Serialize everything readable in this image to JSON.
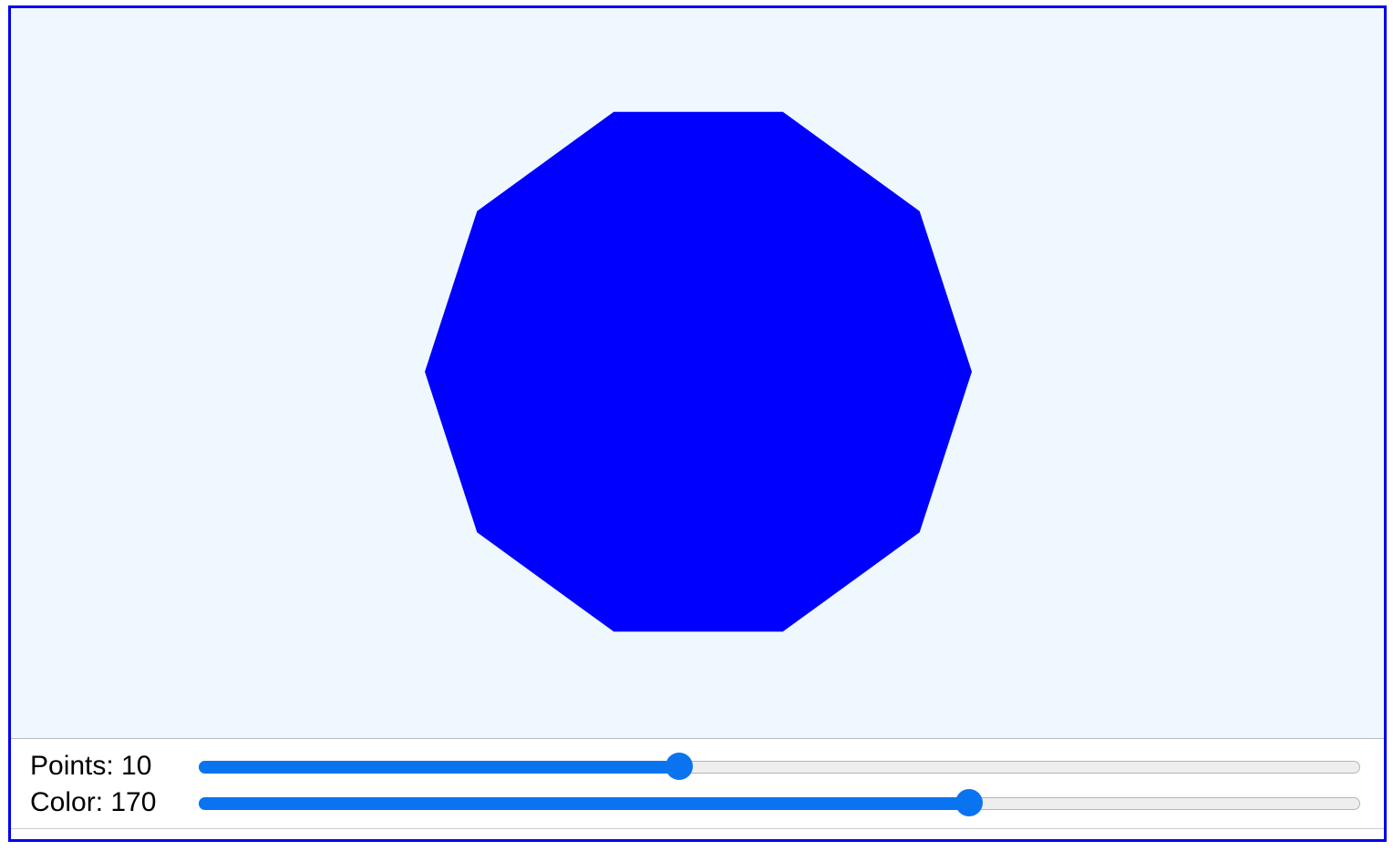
{
  "canvas": {
    "background_color": "#f0f8ff",
    "shape": {
      "type": "regular-polygon",
      "sides": 10,
      "fill_color": "#0000ff"
    }
  },
  "controls": {
    "points": {
      "label": "Points: 10",
      "value": 10,
      "fill_fraction": 0.414
    },
    "color": {
      "label": "Color: 170",
      "value": 170,
      "fill_fraction": 0.663
    },
    "accent_color": "#0a74f0"
  },
  "frame": {
    "border_color": "#0000f0"
  }
}
